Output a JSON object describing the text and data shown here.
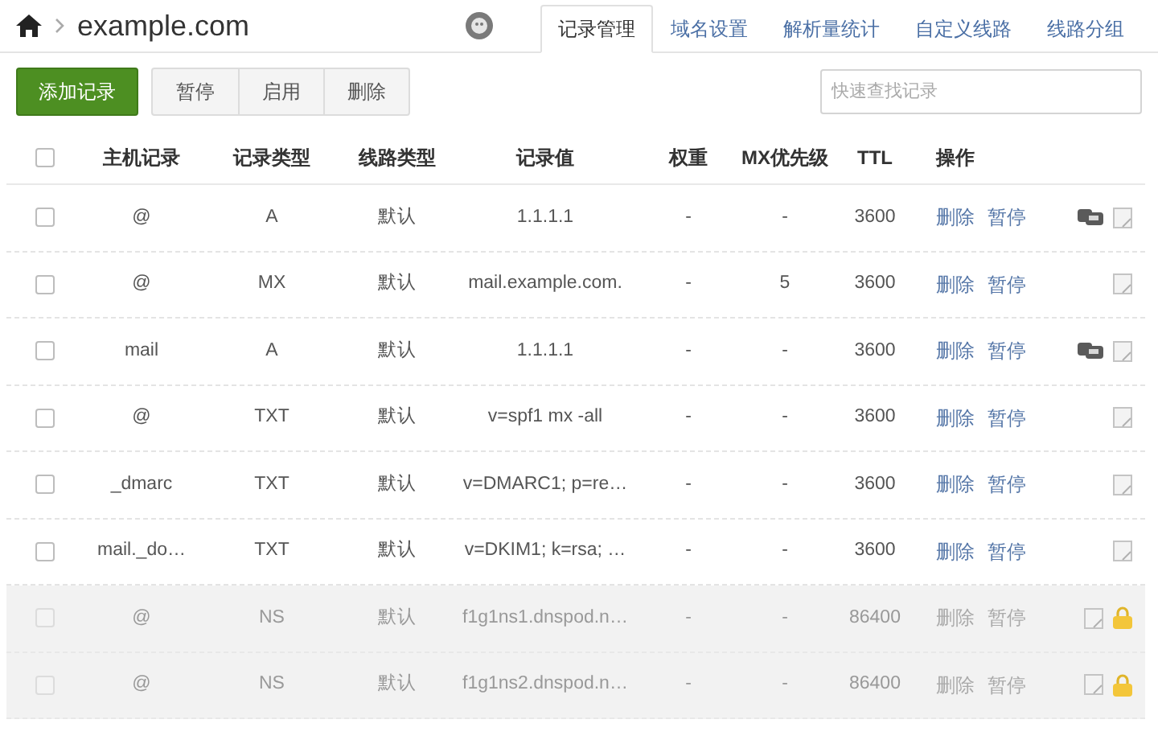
{
  "breadcrumb": {
    "domain": "example.com"
  },
  "tabs": [
    {
      "label": "记录管理",
      "selected": true
    },
    {
      "label": "域名设置",
      "selected": false
    },
    {
      "label": "解析量统计",
      "selected": false
    },
    {
      "label": "自定义线路",
      "selected": false
    },
    {
      "label": "线路分组",
      "selected": false
    }
  ],
  "toolbar": {
    "add_button": "添加记录",
    "buttons": [
      "暂停",
      "启用",
      "删除"
    ],
    "search": {
      "placeholder": "快速查找记录"
    }
  },
  "table": {
    "columns": [
      "主机记录",
      "记录类型",
      "线路类型",
      "记录值",
      "权重",
      "MX优先级",
      "TTL",
      "操作"
    ],
    "header_checked": false,
    "rows": [
      {
        "host": "@",
        "type": "A",
        "line": "默认",
        "value": "1.1.1.1",
        "weight": "-",
        "mx": "-",
        "ttl": "3600",
        "actions": [
          "删除",
          "暂停"
        ],
        "checked": false,
        "disabled": false,
        "monitored": true,
        "locked": false
      },
      {
        "host": "@",
        "type": "MX",
        "line": "默认",
        "value": "mail.example.com.",
        "weight": "-",
        "mx": "5",
        "ttl": "3600",
        "actions": [
          "删除",
          "暂停"
        ],
        "checked": false,
        "disabled": false,
        "monitored": false,
        "locked": false
      },
      {
        "host": "mail",
        "type": "A",
        "line": "默认",
        "value": "1.1.1.1",
        "weight": "-",
        "mx": "-",
        "ttl": "3600",
        "actions": [
          "删除",
          "暂停"
        ],
        "checked": false,
        "disabled": false,
        "monitored": true,
        "locked": false
      },
      {
        "host": "@",
        "type": "TXT",
        "line": "默认",
        "value": "v=spf1 mx -all",
        "weight": "-",
        "mx": "-",
        "ttl": "3600",
        "actions": [
          "删除",
          "暂停"
        ],
        "checked": false,
        "disabled": false,
        "monitored": false,
        "locked": false
      },
      {
        "host": "_dmarc",
        "type": "TXT",
        "line": "默认",
        "value": "v=DMARC1; p=re…",
        "weight": "-",
        "mx": "-",
        "ttl": "3600",
        "actions": [
          "删除",
          "暂停"
        ],
        "checked": false,
        "disabled": false,
        "monitored": false,
        "locked": false
      },
      {
        "host": "mail._do…",
        "type": "TXT",
        "line": "默认",
        "value": "v=DKIM1; k=rsa; …",
        "weight": "-",
        "mx": "-",
        "ttl": "3600",
        "actions": [
          "删除",
          "暂停"
        ],
        "checked": false,
        "disabled": false,
        "monitored": false,
        "locked": false
      },
      {
        "host": "@",
        "type": "NS",
        "line": "默认",
        "value": "f1g1ns1.dnspod.n…",
        "weight": "-",
        "mx": "-",
        "ttl": "86400",
        "actions": [
          "删除",
          "暂停"
        ],
        "checked": false,
        "disabled": true,
        "monitored": false,
        "locked": true
      },
      {
        "host": "@",
        "type": "NS",
        "line": "默认",
        "value": "f1g1ns2.dnspod.n…",
        "weight": "-",
        "mx": "-",
        "ttl": "86400",
        "actions": [
          "删除",
          "暂停"
        ],
        "checked": false,
        "disabled": true,
        "monitored": false,
        "locked": true
      }
    ]
  }
}
